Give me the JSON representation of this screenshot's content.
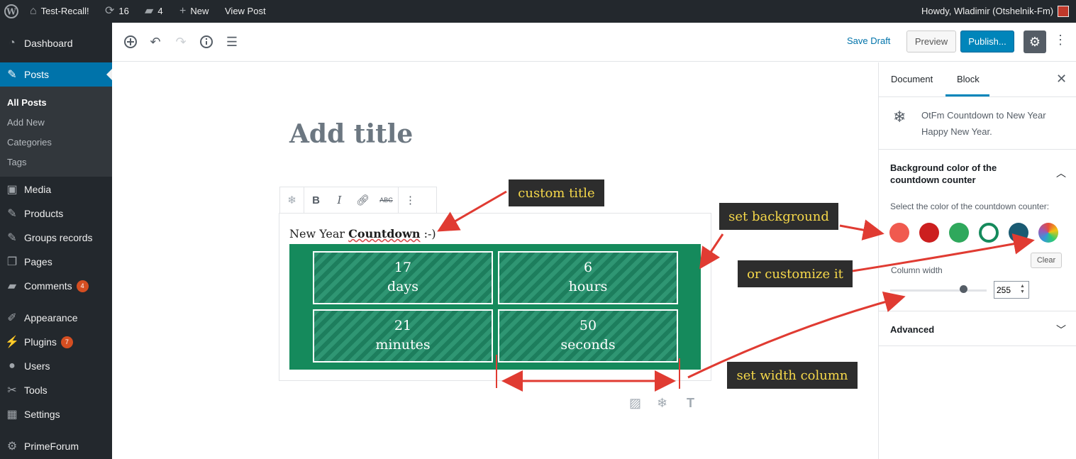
{
  "admin_bar": {
    "site_name": "Test-Recall!",
    "updates_count": "16",
    "comments_count": "4",
    "new_label": "New",
    "view_post_label": "View Post",
    "greeting": "Howdy, Wladimir (Otshelnik-Fm)"
  },
  "sidebar": {
    "items": [
      {
        "label": "Dashboard",
        "icon": "dashboard-icon"
      },
      {
        "label": "Posts",
        "icon": "pin-icon"
      },
      {
        "label": "Media",
        "icon": "media-icon"
      },
      {
        "label": "Products",
        "icon": "pin-icon"
      },
      {
        "label": "Groups records",
        "icon": "pin-icon"
      },
      {
        "label": "Pages",
        "icon": "pages-icon"
      },
      {
        "label": "Comments",
        "icon": "comment-icon",
        "badge": "4"
      },
      {
        "label": "Appearance",
        "icon": "brush-icon"
      },
      {
        "label": "Plugins",
        "icon": "plug-icon",
        "badge": "7"
      },
      {
        "label": "Users",
        "icon": "user-icon"
      },
      {
        "label": "Tools",
        "icon": "wrench-icon"
      },
      {
        "label": "Settings",
        "icon": "settings-icon"
      },
      {
        "label": "PrimeForum",
        "icon": "gear-icon"
      }
    ],
    "posts_submenu": [
      "All Posts",
      "Add New",
      "Categories",
      "Tags"
    ]
  },
  "toolbar": {
    "save_draft": "Save Draft",
    "preview": "Preview",
    "publish": "Publish..."
  },
  "editor": {
    "title_placeholder": "Add title",
    "countdown_title_prefix": "New Year",
    "countdown_title_bold": "Countdown",
    "countdown_title_suffix": ":-)",
    "cells": [
      {
        "value": "17",
        "unit": "days"
      },
      {
        "value": "6",
        "unit": "hours"
      },
      {
        "value": "21",
        "unit": "minutes"
      },
      {
        "value": "50",
        "unit": "seconds"
      }
    ],
    "counter_color": "#158a5c"
  },
  "settings_panel": {
    "tab_document": "Document",
    "tab_block": "Block",
    "block_name": "OtFm Countdown to New Year",
    "block_desc": "Happy New Year.",
    "bg_section_title": "Background color of the countdown counter",
    "bg_select_label": "Select the color of the countdown counter:",
    "swatches": [
      "#f05a4f",
      "#cc1f1f",
      "#2fa85c",
      "#ffffff",
      "#1a5b73",
      "conic"
    ],
    "clear_label": "Clear",
    "column_width_label": "Column width",
    "column_width_value": "255",
    "column_width_fraction": 0.76,
    "advanced_label": "Advanced"
  },
  "annotations": {
    "custom_title": "custom title",
    "set_background": "set background",
    "customize_it": "or customize it",
    "set_width": "set width column"
  }
}
